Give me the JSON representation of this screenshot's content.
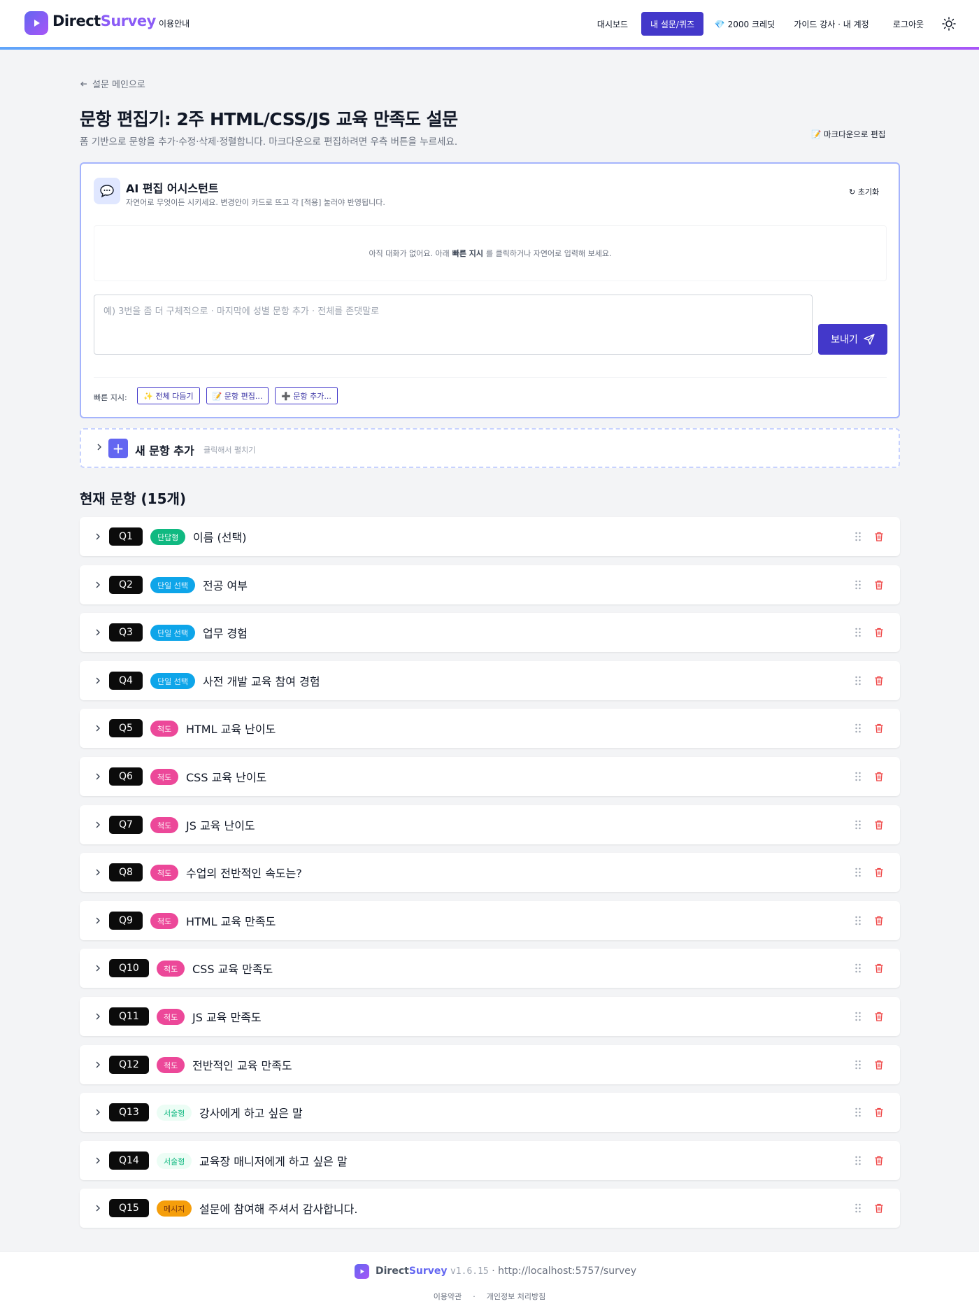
{
  "header": {
    "brand_a": "Direct",
    "brand_b": "Survey",
    "guide_link": "이용안내",
    "nav": {
      "dashboard": "대시보드",
      "my_surveys": "내 설문/퀴즈",
      "credits": "💎 2000 크레딧",
      "guide_account": "가이드 강사 · 내 계정",
      "logout": "로그아웃"
    },
    "theme_icon": "sun-icon"
  },
  "page": {
    "back": "설문 메인으로",
    "title": "문항 편집기: 2주 HTML/CSS/JS 교육 만족도 설문",
    "subtitle": "폼 기반으로 문항을 추가·수정·삭제·정렬합니다. 마크다운으로 편집하려면 우측 버튼을 누르세요.",
    "markdown_edit": "📝 마크다운으로 편집"
  },
  "ai": {
    "title": "AI 편집 어시스턴트",
    "desc": "자연어로 무엇이든 시키세요. 변경안이 카드로 뜨고 각 [적용] 눌러야 반영됩니다.",
    "reset": "↻ 초기화",
    "empty_a": "아직 대화가 없어요. 아래",
    "empty_b": "빠른 지시",
    "empty_c": "를 클릭하거나 자연어로 입력해 보세요.",
    "placeholder": "예) 3번을 좀 더 구체적으로 · 마지막에 성별 문항 추가 · 전체를 존댓말로",
    "send": "보내기",
    "quick_label": "빠른 지시:",
    "quick": [
      "✨ 전체 다듬기",
      "📝 문항 편집...",
      "➕ 문항 추가..."
    ]
  },
  "new_question": {
    "title": "새 문항 추가",
    "hint": "클릭해서 펼치기"
  },
  "questions_title": "현재 문항 (15개)",
  "questions": [
    {
      "num": "Q1",
      "type": "단답형",
      "type_class": "t-short",
      "text": "이름 (선택)"
    },
    {
      "num": "Q2",
      "type": "단일 선택",
      "type_class": "t-single",
      "text": "전공 여부"
    },
    {
      "num": "Q3",
      "type": "단일 선택",
      "type_class": "t-single",
      "text": "업무 경험"
    },
    {
      "num": "Q4",
      "type": "단일 선택",
      "type_class": "t-single",
      "text": "사전 개발 교육 참여 경험"
    },
    {
      "num": "Q5",
      "type": "척도",
      "type_class": "t-scale",
      "text": "HTML 교육 난이도"
    },
    {
      "num": "Q6",
      "type": "척도",
      "type_class": "t-scale",
      "text": "CSS 교육 난이도"
    },
    {
      "num": "Q7",
      "type": "척도",
      "type_class": "t-scale",
      "text": "JS 교육 난이도"
    },
    {
      "num": "Q8",
      "type": "척도",
      "type_class": "t-scale",
      "text": "수업의 전반적인 속도는?"
    },
    {
      "num": "Q9",
      "type": "척도",
      "type_class": "t-scale",
      "text": "HTML 교육 만족도"
    },
    {
      "num": "Q10",
      "type": "척도",
      "type_class": "t-scale",
      "text": "CSS 교육 만족도"
    },
    {
      "num": "Q11",
      "type": "척도",
      "type_class": "t-scale",
      "text": "JS 교육 만족도"
    },
    {
      "num": "Q12",
      "type": "척도",
      "type_class": "t-scale",
      "text": "전반적인 교육 만족도"
    },
    {
      "num": "Q13",
      "type": "서술형",
      "type_class": "t-essay",
      "text": "강사에게 하고 싶은 말"
    },
    {
      "num": "Q14",
      "type": "서술형",
      "type_class": "t-essay",
      "text": "교육장 매니저에게 하고 싶은 말"
    },
    {
      "num": "Q15",
      "type": "메시지",
      "type_class": "t-msg",
      "text": "설문에 참여해 주셔서 감사합니다."
    }
  ],
  "footer": {
    "brand_a": "Direct",
    "brand_b": "Survey",
    "version": "v1.6.15",
    "url": "· http://localhost:5757/survey",
    "terms": "이용약관",
    "sep": "·",
    "privacy": "개인정보 처리방침"
  }
}
